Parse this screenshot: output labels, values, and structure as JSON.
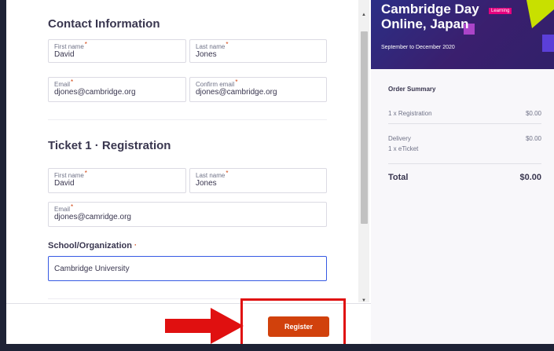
{
  "contact": {
    "title": "Contact Information",
    "first_name_label": "First name",
    "first_name_value": "David",
    "last_name_label": "Last name",
    "last_name_value": "Jones",
    "email_label": "Email",
    "email_value": "djones@cambridge.org",
    "confirm_email_label": "Confirm email",
    "confirm_email_value": "djones@cambridge.org",
    "required_mark": "*"
  },
  "ticket": {
    "title": "Ticket 1 · Registration",
    "first_name_label": "First name",
    "first_name_value": "David",
    "last_name_label": "Last name",
    "last_name_value": "Jones",
    "email_label": "Email",
    "email_value": "djones@camridge.org",
    "school_label": "School/Organization",
    "school_required": "·",
    "school_value": "Cambridge University"
  },
  "footer": {
    "register_label": "Register"
  },
  "event": {
    "title": "Cambridge Day Online, Japan",
    "dates": "September to December 2020",
    "category_badge": "Learning"
  },
  "order_summary": {
    "heading": "Order Summary",
    "lines": [
      {
        "label": "1 x Registration",
        "price": "$0.00"
      },
      {
        "label": "Delivery",
        "sub": "1 x eTicket",
        "price": "$0.00"
      }
    ],
    "total_label": "Total",
    "total_value": "$0.00"
  },
  "colors": {
    "accent": "#d1410c",
    "focus": "#3659e3",
    "annotation_red": "#e01010",
    "page_bg": "#1e2235"
  },
  "icons": {
    "scroll_up": "scroll-up-arrow-icon",
    "scroll_down": "scroll-down-arrow-icon",
    "annotation_arrow": "red-arrow-icon"
  }
}
